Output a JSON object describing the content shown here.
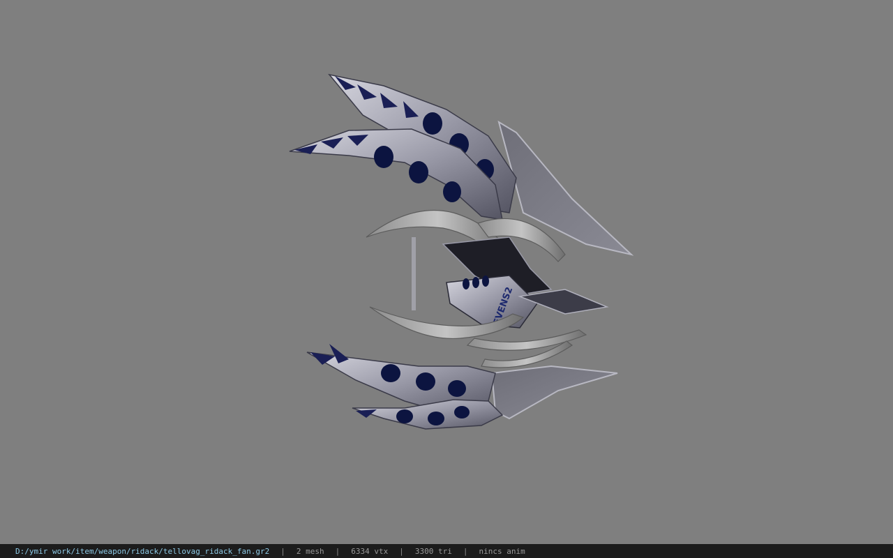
{
  "status_bar": {
    "file_path": "D:/ymir work/item/weapon/ridack/tellovag_ridack_fan.gr2",
    "separator": "|",
    "mesh_count": "2 mesh",
    "vertex_count": "6334 vtx",
    "triangle_count": "3300 tri",
    "animation": "nincs anim"
  },
  "model": {
    "icon": "weapon-fan-model",
    "emblem_text": "EVENS2"
  },
  "colors": {
    "viewport_bg": "#7f7f7f",
    "status_bg": "#1c1c1c",
    "path_text": "#8ecae6",
    "stat_text": "#9a9a9a",
    "metal_light": "#b9b9c4",
    "metal_dark": "#4a4a58",
    "inset_blue": "#0c1440"
  }
}
